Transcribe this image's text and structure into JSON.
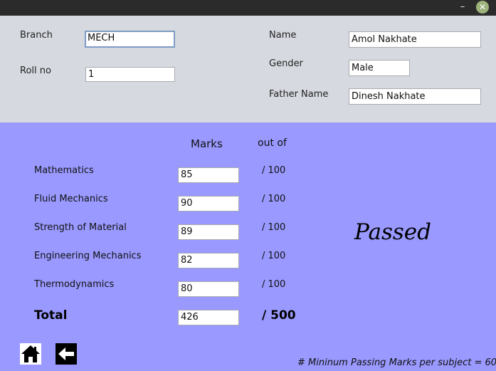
{
  "titlebar": {
    "minimize_glyph": "–",
    "close_glyph": "✕"
  },
  "student": {
    "branch_label": "Branch",
    "branch_value": "MECH",
    "rollno_label": "Roll no",
    "rollno_value": "1",
    "name_label": "Name",
    "name_value": "Amol Nakhate",
    "gender_label": "Gender",
    "gender_value": "Male",
    "father_label": "Father Name",
    "father_value": "Dinesh Nakhate"
  },
  "marks": {
    "header_marks": "Marks",
    "header_outof": "out of",
    "subjects": [
      {
        "name": "Mathematics",
        "mark": "85",
        "outof": "/ 100"
      },
      {
        "name": "Fluid Mechanics",
        "mark": "90",
        "outof": "/ 100"
      },
      {
        "name": "Strength of Material",
        "mark": "89",
        "outof": "/ 100"
      },
      {
        "name": "Engineering Mechanics",
        "mark": "82",
        "outof": "/ 100"
      },
      {
        "name": "Thermodynamics",
        "mark": "80",
        "outof": "/ 100"
      }
    ],
    "total_label": "Total",
    "total_value": "426",
    "total_outof": "/ 500"
  },
  "result": "Passed",
  "footer_note": "# Mininum Passing Marks per subject = 60",
  "icons": {
    "home": "home-icon",
    "back": "arrow-left-icon"
  },
  "colors": {
    "top_bg": "#d6d9df",
    "bottom_bg": "#9999ff",
    "titlebar": "#2b2b2b",
    "close": "#9cb27a"
  }
}
